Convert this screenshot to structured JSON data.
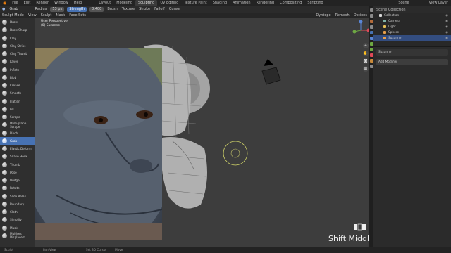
{
  "topbar": {
    "menus": [
      "File",
      "Edit",
      "Render",
      "Window",
      "Help"
    ],
    "workspaces": [
      "Layout",
      "Modeling",
      "Sculpting",
      "UV Editing",
      "Texture Paint",
      "Shading",
      "Animation",
      "Rendering",
      "Compositing",
      "Scripting"
    ],
    "active_workspace": "Sculpting",
    "scene": "Scene",
    "view_layer": "View Layer"
  },
  "tool_header": {
    "brush": "Grab",
    "radius_label": "Radius",
    "radius_value": "53 px",
    "strength_label": "Strength",
    "strength_value": "0.400",
    "menus": [
      "Brush",
      "Texture",
      "Stroke",
      "Falloff",
      "Cursor"
    ]
  },
  "mode_header": {
    "mode": "Sculpt Mode",
    "menus": [
      "View",
      "Sculpt",
      "Mask",
      "Face Sets"
    ],
    "right": [
      "Dyntopo",
      "Remesh",
      "Options"
    ]
  },
  "viewport": {
    "view_name": "User Perspective",
    "object_name": "(0) Suzanne"
  },
  "tools": [
    "Draw",
    "Draw Sharp",
    "Clay",
    "Clay Strips",
    "Clay Thumb",
    "Layer",
    "Inflate",
    "Blob",
    "Crease",
    "Smooth",
    "Flatten",
    "Fill",
    "Scrape",
    "Multi-plane Scrape",
    "Pinch",
    "Grab",
    "Elastic Deform",
    "Snake Hook",
    "Thumb",
    "Pose",
    "Nudge",
    "Rotate",
    "Slide Relax",
    "Boundary",
    "Cloth",
    "Simplify",
    "Mask",
    "Multires Displacem..."
  ],
  "active_tool": "Grab",
  "outliner": {
    "header": "Scene Collection",
    "rows": [
      {
        "name": "Collection",
        "icon_color": "#d9d9d9",
        "selected": false
      },
      {
        "name": "Camera",
        "icon_color": "#7fb2a8",
        "selected": false
      },
      {
        "name": "Light",
        "icon_color": "#e8c256",
        "selected": false
      },
      {
        "name": "Sphere",
        "icon_color": "#e79f4a",
        "selected": false
      },
      {
        "name": "Suzanne",
        "icon_color": "#e79f4a",
        "selected": true
      }
    ]
  },
  "properties": {
    "object": "Suzanne",
    "add_modifier": "Add Modifier"
  },
  "overlay_key": "Shift Middle",
  "statusbar": [
    "Sculpt",
    "Pan View",
    "Set 3D Cursor",
    "Move"
  ],
  "colors": {
    "accent": "#4772b3",
    "background": "#3d3d3d",
    "brush_circle": "#d6d96a"
  }
}
